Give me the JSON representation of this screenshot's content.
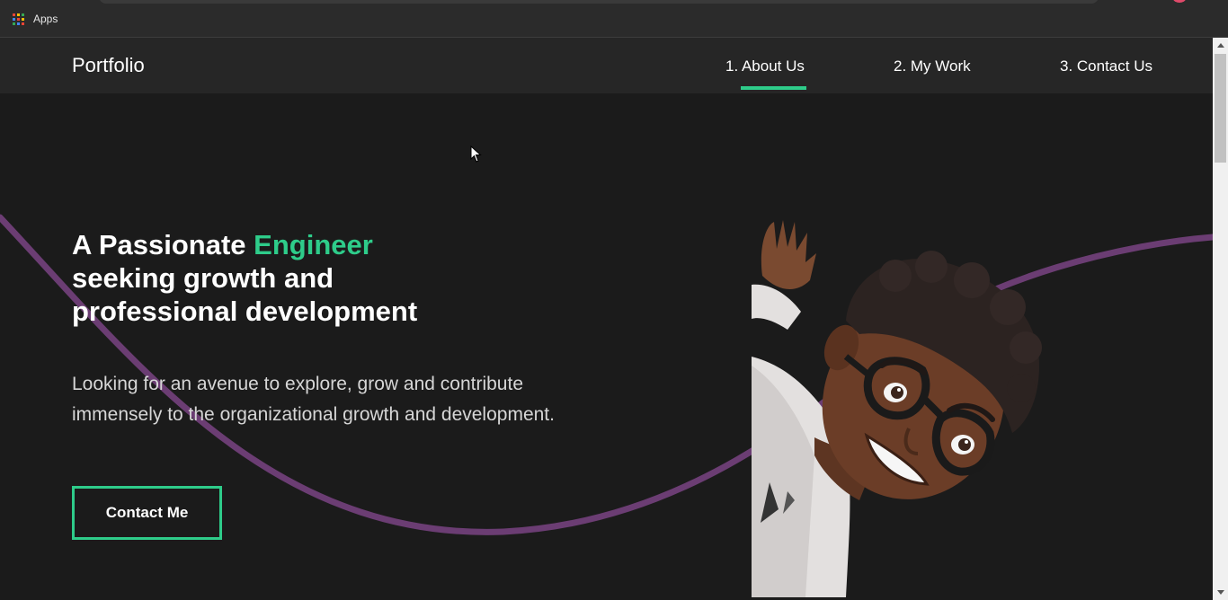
{
  "browser": {
    "bookmarks": {
      "apps_label": "Apps",
      "apps_icon": "apps-grid-icon"
    }
  },
  "site": {
    "logo": "Portfolio",
    "nav": [
      {
        "label": "1. About Us",
        "active": true
      },
      {
        "label": "2. My Work",
        "active": false
      },
      {
        "label": "3. Contact Us",
        "active": false
      }
    ]
  },
  "hero": {
    "title_prefix": "A Passionate ",
    "title_accent": "Engineer",
    "title_line2": "seeking growth and",
    "title_line3": "professional development",
    "subtitle": "Looking for an avenue to explore, grow and contribute immensely to the organizational growth and development.",
    "cta_label": "Contact Me"
  },
  "colors": {
    "accent": "#2ecc8a",
    "wave": "#6b3d73",
    "background": "#1b1b1b",
    "navbar": "#262626"
  }
}
